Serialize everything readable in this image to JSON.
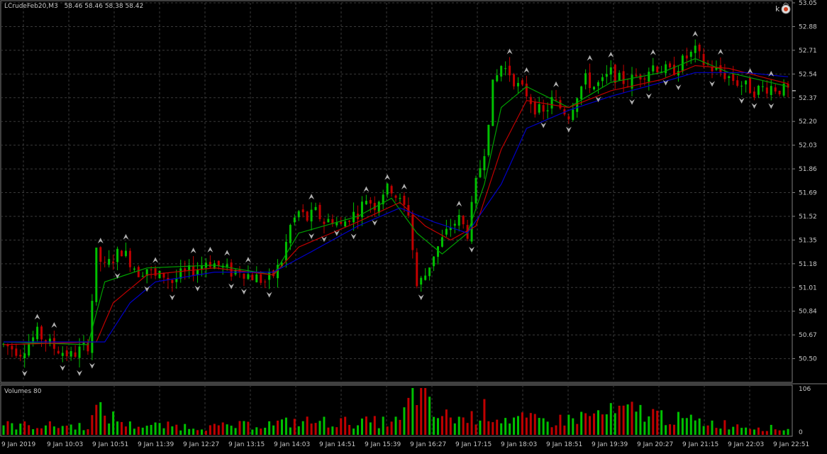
{
  "header": {
    "symbol": "LCrudeFeb20,M3",
    "ohlc": "58.46 58.46 58.38 58.42"
  },
  "volume_panel": {
    "title": "Volumes 80",
    "scale_max": "106",
    "scale_min": "0"
  },
  "colors": {
    "background": "#000000",
    "grid": "#3a3a3a",
    "bull_candle": "#00c000",
    "bear_candle": "#c00000",
    "ma_fast": "#00a000",
    "ma_mid": "#c00000",
    "ma_slow": "#0000c8",
    "fractal": "#b0b0b0",
    "text": "#c8c8c8"
  },
  "icons": [
    "tools-icon",
    "expert-smile-icon"
  ],
  "chart_data": [
    {
      "type": "candlestick",
      "title": "LCrudeFeb20,M3",
      "y_ticks": [
        "53.05",
        "52.88",
        "52.71",
        "52.54",
        "52.37",
        "52.20",
        "52.03",
        "51.86",
        "51.69",
        "51.52",
        "51.35",
        "51.18",
        "51.01",
        "50.84",
        "50.67",
        "50.50"
      ],
      "ylim": [
        50.33,
        53.05
      ],
      "x_ticks": [
        "9 Jan 2019",
        "9 Jan 10:03",
        "9 Jan 10:51",
        "9 Jan 11:39",
        "9 Jan 12:27",
        "9 Jan 13:15",
        "9 Jan 14:03",
        "9 Jan 14:51",
        "9 Jan 15:39",
        "9 Jan 16:27",
        "9 Jan 17:15",
        "9 Jan 18:03",
        "9 Jan 18:51",
        "9 Jan 19:39",
        "9 Jan 20:27",
        "9 Jan 21:15",
        "9 Jan 22:03",
        "9 Jan 22:51"
      ],
      "grid": true,
      "last_price": 52.42,
      "close_path": [
        [
          0,
          50.6
        ],
        [
          4,
          50.55
        ],
        [
          8,
          50.68
        ],
        [
          12,
          50.58
        ],
        [
          16,
          50.52
        ],
        [
          20,
          50.6
        ],
        [
          22,
          51.25
        ],
        [
          24,
          51.15
        ],
        [
          26,
          51.22
        ],
        [
          28,
          51.28
        ],
        [
          30,
          51.2
        ],
        [
          32,
          51.12
        ],
        [
          34,
          51.15
        ],
        [
          36,
          51.08
        ],
        [
          38,
          51.1
        ],
        [
          40,
          51.05
        ],
        [
          42,
          51.1
        ],
        [
          44,
          51.12
        ],
        [
          46,
          51.15
        ],
        [
          48,
          51.2
        ],
        [
          50,
          51.18
        ],
        [
          52,
          51.15
        ],
        [
          54,
          51.12
        ],
        [
          56,
          51.14
        ],
        [
          58,
          51.1
        ],
        [
          60,
          51.08
        ],
        [
          62,
          51.05
        ],
        [
          64,
          51.1
        ],
        [
          66,
          51.2
        ],
        [
          68,
          51.45
        ],
        [
          70,
          51.55
        ],
        [
          72,
          51.5
        ],
        [
          74,
          51.55
        ],
        [
          76,
          51.48
        ],
        [
          78,
          51.5
        ],
        [
          80,
          51.45
        ],
        [
          82,
          51.52
        ],
        [
          84,
          51.55
        ],
        [
          86,
          51.65
        ],
        [
          88,
          51.6
        ],
        [
          90,
          51.7
        ],
        [
          92,
          51.72
        ],
        [
          94,
          51.62
        ],
        [
          96,
          51.55
        ],
        [
          98,
          51.02
        ],
        [
          100,
          51.1
        ],
        [
          102,
          51.25
        ],
        [
          104,
          51.35
        ],
        [
          106,
          51.45
        ],
        [
          108,
          51.5
        ],
        [
          110,
          51.4
        ],
        [
          112,
          51.75
        ],
        [
          114,
          52.0
        ],
        [
          116,
          52.45
        ],
        [
          118,
          52.6
        ],
        [
          120,
          52.55
        ],
        [
          122,
          52.45
        ],
        [
          124,
          52.4
        ],
        [
          126,
          52.3
        ],
        [
          128,
          52.25
        ],
        [
          130,
          52.35
        ],
        [
          132,
          52.3
        ],
        [
          134,
          52.25
        ],
        [
          136,
          52.4
        ],
        [
          138,
          52.5
        ],
        [
          140,
          52.45
        ],
        [
          142,
          52.48
        ],
        [
          144,
          52.55
        ],
        [
          146,
          52.5
        ],
        [
          148,
          52.48
        ],
        [
          150,
          52.52
        ],
        [
          152,
          52.55
        ],
        [
          154,
          52.6
        ],
        [
          156,
          52.58
        ],
        [
          158,
          52.55
        ],
        [
          160,
          52.6
        ],
        [
          162,
          52.66
        ],
        [
          164,
          52.7
        ],
        [
          166,
          52.62
        ],
        [
          168,
          52.58
        ],
        [
          170,
          52.55
        ],
        [
          172,
          52.52
        ],
        [
          174,
          52.48
        ],
        [
          176,
          52.45
        ],
        [
          178,
          52.42
        ],
        [
          180,
          52.44
        ],
        [
          182,
          52.45
        ],
        [
          184,
          52.43
        ],
        [
          186,
          52.42
        ]
      ],
      "ma_fast_path": [
        [
          0,
          50.62
        ],
        [
          20,
          50.6
        ],
        [
          24,
          51.05
        ],
        [
          34,
          51.15
        ],
        [
          50,
          51.17
        ],
        [
          64,
          51.1
        ],
        [
          70,
          51.4
        ],
        [
          84,
          51.52
        ],
        [
          92,
          51.65
        ],
        [
          98,
          51.4
        ],
        [
          104,
          51.25
        ],
        [
          110,
          51.4
        ],
        [
          114,
          51.75
        ],
        [
          118,
          52.3
        ],
        [
          124,
          52.45
        ],
        [
          134,
          52.3
        ],
        [
          144,
          52.48
        ],
        [
          156,
          52.55
        ],
        [
          164,
          52.65
        ],
        [
          172,
          52.55
        ],
        [
          186,
          52.45
        ]
      ],
      "ma_mid_path": [
        [
          0,
          50.6
        ],
        [
          22,
          50.62
        ],
        [
          26,
          50.9
        ],
        [
          34,
          51.1
        ],
        [
          50,
          51.15
        ],
        [
          64,
          51.1
        ],
        [
          70,
          51.3
        ],
        [
          84,
          51.48
        ],
        [
          94,
          51.62
        ],
        [
          100,
          51.45
        ],
        [
          106,
          51.35
        ],
        [
          112,
          51.45
        ],
        [
          118,
          52.0
        ],
        [
          124,
          52.35
        ],
        [
          134,
          52.3
        ],
        [
          144,
          52.42
        ],
        [
          156,
          52.5
        ],
        [
          164,
          52.6
        ],
        [
          172,
          52.58
        ],
        [
          186,
          52.47
        ]
      ],
      "ma_slow_path": [
        [
          0,
          50.62
        ],
        [
          24,
          50.62
        ],
        [
          30,
          50.9
        ],
        [
          36,
          51.05
        ],
        [
          50,
          51.12
        ],
        [
          64,
          51.12
        ],
        [
          72,
          51.25
        ],
        [
          84,
          51.45
        ],
        [
          94,
          51.58
        ],
        [
          102,
          51.48
        ],
        [
          110,
          51.4
        ],
        [
          118,
          51.75
        ],
        [
          124,
          52.15
        ],
        [
          134,
          52.28
        ],
        [
          144,
          52.38
        ],
        [
          156,
          52.48
        ],
        [
          164,
          52.55
        ],
        [
          176,
          52.55
        ],
        [
          186,
          52.52
        ]
      ]
    },
    {
      "type": "bar",
      "title": "Volumes 80",
      "ylim": [
        0,
        106
      ],
      "volume_profile": [
        [
          0,
          22
        ],
        [
          20,
          20
        ],
        [
          22,
          55
        ],
        [
          30,
          22
        ],
        [
          50,
          18
        ],
        [
          64,
          25
        ],
        [
          70,
          30
        ],
        [
          84,
          28
        ],
        [
          94,
          30
        ],
        [
          98,
          106
        ],
        [
          102,
          45
        ],
        [
          110,
          35
        ],
        [
          114,
          55
        ],
        [
          118,
          38
        ],
        [
          130,
          30
        ],
        [
          140,
          45
        ],
        [
          150,
          55
        ],
        [
          160,
          35
        ],
        [
          170,
          25
        ],
        [
          186,
          12
        ]
      ]
    }
  ]
}
